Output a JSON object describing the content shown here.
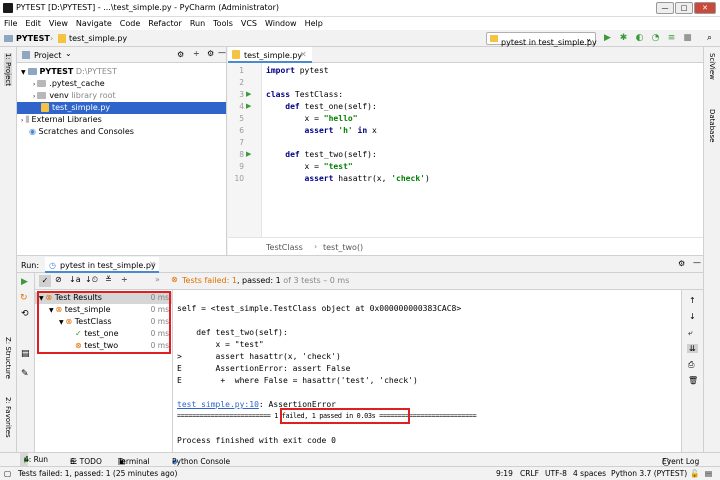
{
  "window": {
    "title": "PYTEST [D:\\PYTEST] - ...\\test_simple.py - PyCharm (Administrator)",
    "minimize": "—",
    "maximize": "□",
    "close": "✕"
  },
  "menu": [
    "File",
    "Edit",
    "View",
    "Navigate",
    "Code",
    "Refactor",
    "Run",
    "Tools",
    "VCS",
    "Window",
    "Help"
  ],
  "navbar": {
    "project": "PYTEST",
    "file": "test_simple.py",
    "run_config": "pytest in test_simple.py"
  },
  "left_strip": {
    "project_tab": "1: Project",
    "structure_tab": "Z: Structure",
    "favorites_tab": "2: Favorites"
  },
  "right_strip": {
    "sciview": "SciView",
    "database": "Database"
  },
  "project_panel": {
    "title": "Project",
    "items": [
      {
        "label": "PYTEST",
        "hint": "D:\\PYTEST"
      },
      {
        "label": ".pytest_cache"
      },
      {
        "label": "venv",
        "hint": "library root"
      },
      {
        "label": "test_simple.py"
      },
      {
        "label": "External Libraries"
      },
      {
        "label": "Scratches and Consoles"
      }
    ]
  },
  "editor": {
    "tab": "test_simple.py",
    "line_numbers": [
      "1",
      "2",
      "3",
      "4",
      "5",
      "6",
      "7",
      "8",
      "9",
      "10"
    ],
    "lines": [
      {
        "parts": [
          {
            "c": "kw",
            "t": "import "
          },
          {
            "c": "fn",
            "t": "pytest"
          }
        ]
      },
      {
        "parts": []
      },
      {
        "parts": [
          {
            "c": "kw",
            "t": "class "
          },
          {
            "c": "fn",
            "t": "TestClass:"
          }
        ]
      },
      {
        "parts": [
          {
            "c": "fn",
            "t": "    "
          },
          {
            "c": "kw",
            "t": "def "
          },
          {
            "c": "fn",
            "t": "test_one(self):"
          }
        ]
      },
      {
        "parts": [
          {
            "c": "fn",
            "t": "        x = "
          },
          {
            "c": "str",
            "t": "\"hello\""
          }
        ]
      },
      {
        "parts": [
          {
            "c": "fn",
            "t": "        "
          },
          {
            "c": "kw",
            "t": "assert "
          },
          {
            "c": "str",
            "t": "'h'"
          },
          {
            "c": "fn",
            "t": " "
          },
          {
            "c": "kw",
            "t": "in "
          },
          {
            "c": "fn",
            "t": "x"
          }
        ]
      },
      {
        "parts": []
      },
      {
        "parts": [
          {
            "c": "fn",
            "t": "    "
          },
          {
            "c": "kw",
            "t": "def "
          },
          {
            "c": "fn",
            "t": "test_two(self):"
          }
        ]
      },
      {
        "parts": [
          {
            "c": "fn",
            "t": "        x = "
          },
          {
            "c": "str",
            "t": "\"test\""
          }
        ]
      },
      {
        "parts": [
          {
            "c": "fn",
            "t": "        "
          },
          {
            "c": "kw",
            "t": "assert "
          },
          {
            "c": "fn",
            "t": "hasattr(x, "
          },
          {
            "c": "str",
            "t": "'check'"
          },
          {
            "c": "fn",
            "t": ")"
          }
        ]
      }
    ],
    "breadcrumb": [
      "TestClass",
      "test_two()"
    ]
  },
  "run": {
    "label": "Run:",
    "tab": "pytest in test_simple.py",
    "status_prefix": "Tests failed:",
    "status_failed": "1",
    "status_mid": ", passed:",
    "status_passed": "1",
    "status_suffix": "of 3 tests – 0 ms",
    "tree": [
      {
        "label": "Test Results",
        "time": "0 ms"
      },
      {
        "label": "test_simple",
        "time": "0 ms"
      },
      {
        "label": "TestClass",
        "time": "0 ms"
      },
      {
        "label": "test_one",
        "time": "0 ms"
      },
      {
        "label": "test_two",
        "time": "0 ms"
      }
    ],
    "console": [
      "self = <test_simple.TestClass object at 0x000000000383CAC8>",
      "",
      "    def test_two(self):",
      "        x = \"test\"",
      ">       assert hasattr(x, 'check')",
      "E       AssertionError: assert False",
      "E        +  where False = hasattr('test', 'check')",
      "",
      "test_simple.py:10: AssertionError",
      "========================= 1 failed, 1 passed in 0.03s ==========================",
      "",
      "Process finished with exit code 0"
    ],
    "summary": "1 failed, 1 passed in 0.03s",
    "link": "test_simple.py:10",
    "link_rest": ": AssertionError"
  },
  "bottom_tabs": [
    "4: Run",
    "6: TODO",
    "Terminal",
    "Python Console"
  ],
  "event_log": "Event Log",
  "status": {
    "message": "Tests failed: 1, passed: 1 (25 minutes ago)",
    "position": "9:19",
    "line_sep": "CRLF",
    "encoding": "UTF-8",
    "indent": "4 spaces",
    "interpreter": "Python 3.7 (PYTEST)"
  },
  "colors": {
    "highlight_box": "#e02020",
    "pass": "#3a9a3a",
    "fail": "#e07000",
    "selection": "#2f65ca"
  }
}
